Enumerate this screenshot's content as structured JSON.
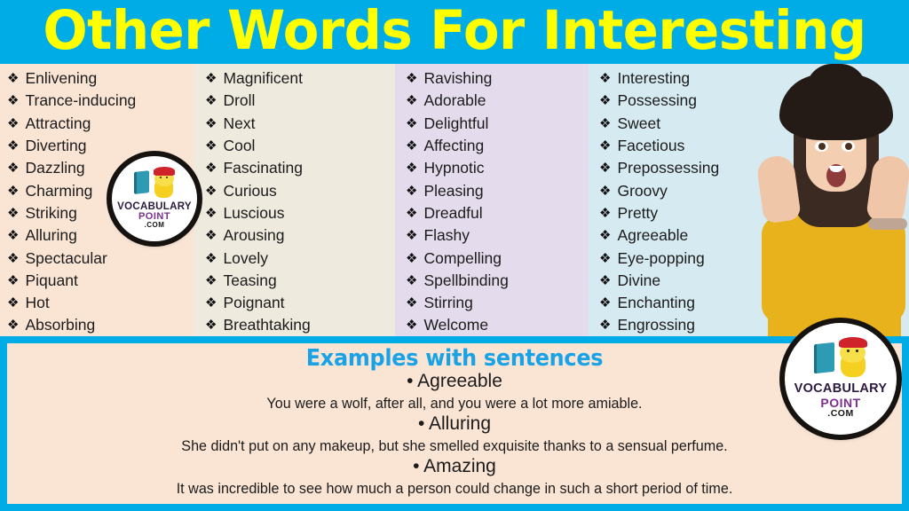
{
  "header": {
    "title": "Other Words For Interesting",
    "background_color": "#00ace6",
    "title_color": "#ffff00"
  },
  "columns": [
    {
      "background_color": "#fae5d5",
      "bullet": "❖",
      "words": [
        "Enlivening",
        "Trance-inducing",
        "Attracting",
        "Diverting",
        "Dazzling",
        "Charming",
        "Striking",
        "Alluring",
        "Spectacular",
        "Piquant",
        "Hot",
        "Absorbing"
      ]
    },
    {
      "background_color": "#eeeade",
      "bullet": "❖",
      "words": [
        "Magnificent",
        "Droll",
        "Next",
        "Cool",
        "Fascinating",
        "Curious",
        "Luscious",
        "Arousing",
        "Lovely",
        "Teasing",
        "Poignant",
        "Breathtaking"
      ]
    },
    {
      "background_color": "#e4dced",
      "bullet": "❖",
      "words": [
        "Ravishing",
        "Adorable",
        "Delightful",
        "Affecting",
        "Hypnotic",
        "Pleasing",
        "Dreadful",
        "Flashy",
        "Compelling",
        "Spellbinding",
        "Stirring",
        "Welcome"
      ]
    },
    {
      "background_color": "#d6eaf2",
      "bullet": "❖",
      "words": [
        "Interesting",
        "Possessing",
        "Sweet",
        "Facetious",
        "Prepossessing",
        "Groovy",
        "Pretty",
        "Agreeable",
        "Eye-popping",
        "Divine",
        "Enchanting",
        "Engrossing"
      ]
    }
  ],
  "logo": {
    "line1": "VOCABULARY",
    "line2": "POINT",
    "line3": ".COM",
    "line1_color": "#2b1b3d",
    "line2_color": "#7b2f8f",
    "line3_color": "#161616"
  },
  "examples": {
    "heading": "Examples with sentences",
    "heading_color": "#19a3e6",
    "background_color": "#fae5d5",
    "border_color": "#00ace6",
    "entries": [
      {
        "word": "• Agreeable",
        "sentence": "You were a wolf, after all, and you were a lot more amiable."
      },
      {
        "word": "• Alluring",
        "sentence": "She didn't put on any makeup, but she smelled exquisite thanks to a sensual perfume."
      },
      {
        "word": "• Amazing",
        "sentence": "It was incredible to see how much a person could change in such a short period of time."
      }
    ]
  },
  "photo": {
    "description": "excited woman in black hat and yellow sweater"
  }
}
